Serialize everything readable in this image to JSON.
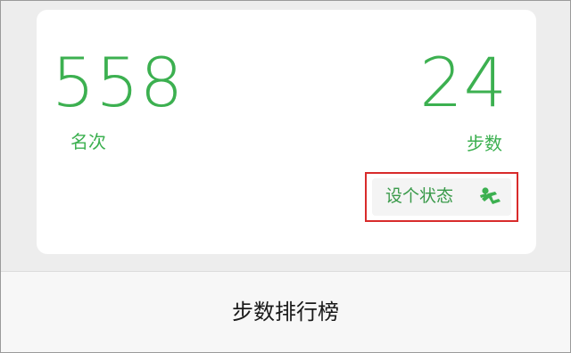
{
  "card": {
    "rank_value": "558",
    "rank_label": "名次",
    "steps_value": "24",
    "steps_label": "步数",
    "status_button_label": "设个状态",
    "status_icon": "runner-icon"
  },
  "bottom": {
    "leaderboard_label": "步数排行榜"
  },
  "colors": {
    "accent_green": "#3cb050",
    "highlight_red": "#d82b2b"
  }
}
